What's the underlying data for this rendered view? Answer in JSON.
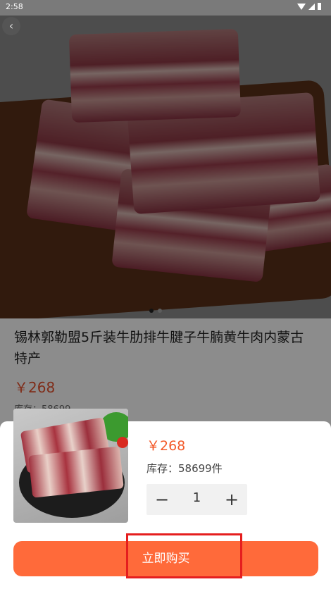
{
  "status_bar": {
    "time": "2:58"
  },
  "product": {
    "title": "锡林郭勒盟5斤装牛肋排牛腱子牛腩黄牛肉内蒙古特产",
    "price": "￥268",
    "stock": "库存：58699"
  },
  "sheet": {
    "price": "￥268",
    "stock": "库存：58699件",
    "quantity": "1",
    "minus": "−",
    "plus": "+",
    "buy_label": "立即购买"
  },
  "icons": {
    "back": "back-arrow-icon",
    "wifi": "wifi-icon",
    "signal": "signal-icon",
    "battery": "battery-icon"
  },
  "colors": {
    "accent": "#ff6a3a",
    "price": "#f35a2a",
    "highlight": "#e51e1e"
  }
}
